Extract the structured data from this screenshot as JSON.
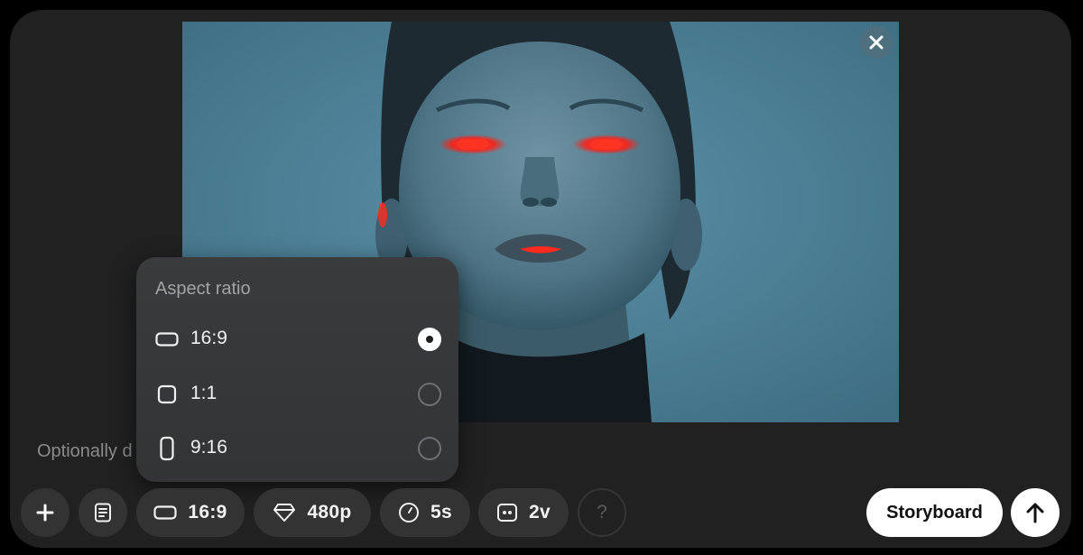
{
  "prompt": {
    "text": "Optionally d"
  },
  "aspect_menu": {
    "title": "Aspect ratio",
    "options": [
      {
        "label": "16:9",
        "icon": "landscape-rect-icon",
        "selected": true
      },
      {
        "label": "1:1",
        "icon": "square-rect-icon",
        "selected": false
      },
      {
        "label": "9:16",
        "icon": "portrait-rect-icon",
        "selected": false
      }
    ]
  },
  "toolbar": {
    "add_icon": "plus-icon",
    "storyboard_icon": "document-list-icon",
    "aspect_value": "16:9",
    "resolution": "480p",
    "duration": "5s",
    "variations": "2v",
    "help": "?",
    "storyboard_label": "Storyboard",
    "submit_icon": "arrow-up-icon"
  },
  "colors": {
    "panel": "#212121",
    "pill": "#333333",
    "popover": "#363738",
    "image_bg": "#4b7d93",
    "eye_glow": "#ff2a1e"
  }
}
